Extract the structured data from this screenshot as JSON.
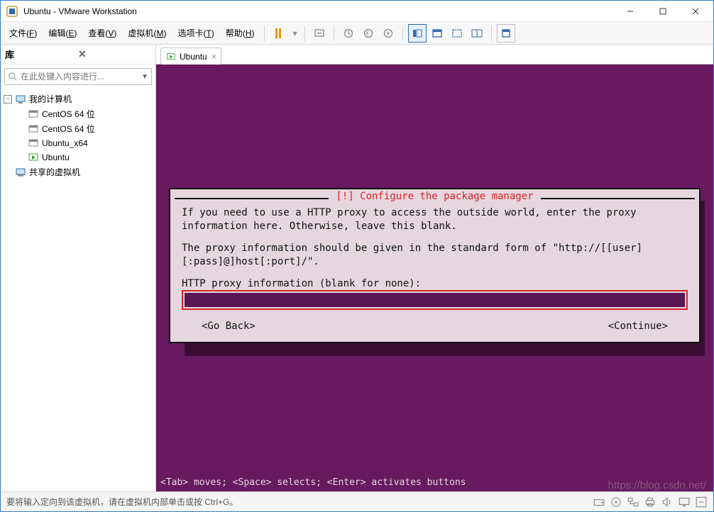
{
  "window": {
    "title": "Ubuntu - VMware Workstation"
  },
  "menubar": {
    "items": [
      {
        "label": "文件",
        "key": "F"
      },
      {
        "label": "编辑",
        "key": "E"
      },
      {
        "label": "查看",
        "key": "V"
      },
      {
        "label": "虚拟机",
        "key": "M"
      },
      {
        "label": "选项卡",
        "key": "T"
      },
      {
        "label": "帮助",
        "key": "H"
      }
    ]
  },
  "sidebar": {
    "title": "库",
    "search_placeholder": "在此处键入内容进行...",
    "tree": {
      "root": {
        "label": "我的计算机"
      },
      "children": [
        {
          "label": "CentOS 64 位"
        },
        {
          "label": "CentOS 64 位"
        },
        {
          "label": "Ubuntu_x64"
        },
        {
          "label": "Ubuntu",
          "active": true
        }
      ],
      "shared": {
        "label": "共享的虚拟机"
      }
    }
  },
  "tabs": {
    "active": {
      "label": "Ubuntu"
    }
  },
  "installer": {
    "title": "[!] Configure the package manager",
    "para1": "If you need to use a HTTP proxy to access the outside world, enter the proxy information here. Otherwise, leave this blank.",
    "para2": "The proxy information should be given in the standard form of \"http://[[user][:pass]@]host[:port]/\".",
    "field_label": "HTTP proxy information (blank for none):",
    "go_back": "<Go Back>",
    "continue": "<Continue>",
    "helpbar": "<Tab> moves; <Space> selects; <Enter> activates buttons"
  },
  "statusbar": {
    "text": "要将输入定向到该虚拟机，请在虚拟机内部单击或按 Ctrl+G。"
  },
  "watermark": "https://blog.csdn.net/"
}
